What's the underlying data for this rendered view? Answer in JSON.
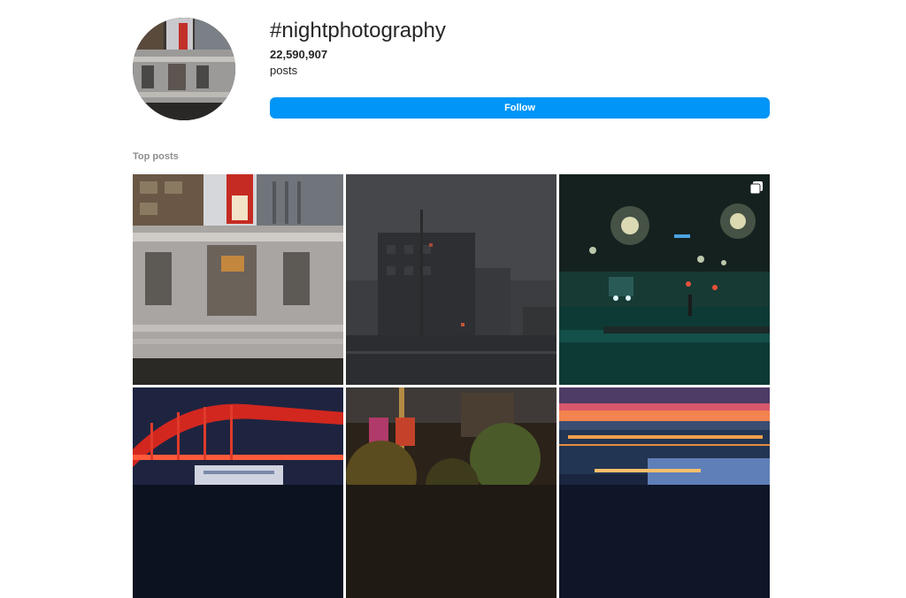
{
  "hashtag": {
    "title": "#nightphotography",
    "post_count": "22,590,907",
    "post_label": "posts",
    "follow_label": "Follow",
    "accent_color": "#0095f6"
  },
  "top_posts": {
    "section_label": "Top posts",
    "posts": [
      {
        "subject": "blurred elevated train passing Chicago CHI sign"
      },
      {
        "subject": "foggy dark city street with apartment building"
      },
      {
        "subject": "misty teal street at night with streetlights and bus",
        "multi_image": true
      },
      {
        "subject": "red lit bridge over cruise ship at night"
      },
      {
        "subject": "street banners and trees at dusk"
      },
      {
        "subject": "city skyline and river bridge at sunset"
      }
    ]
  }
}
